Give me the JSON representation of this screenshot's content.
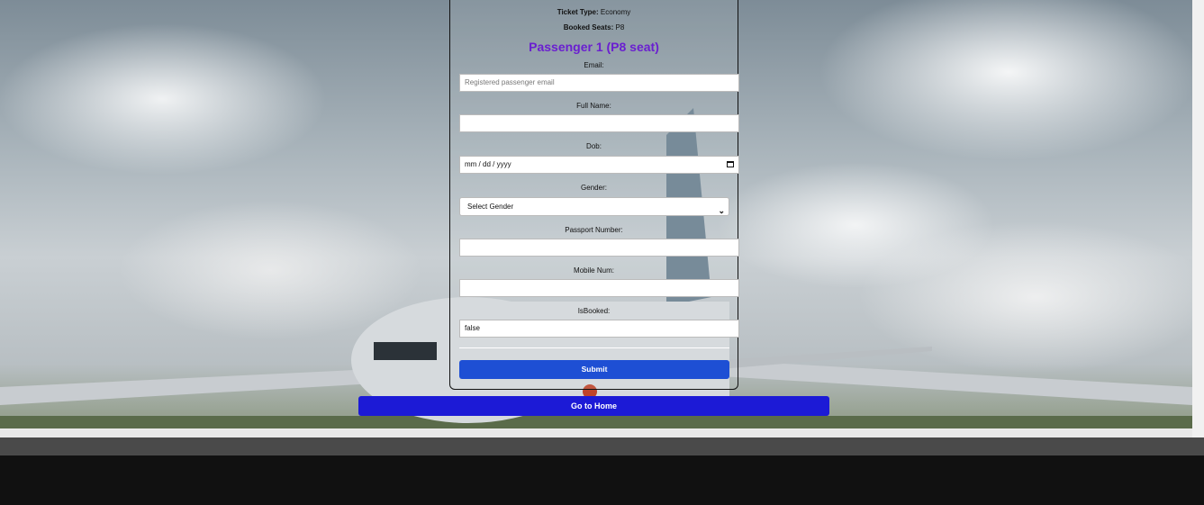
{
  "booking": {
    "ticket_type_label": "Ticket Type:",
    "ticket_type_value": "Economy",
    "booked_seats_label": "Booked Seats:",
    "booked_seats_value": "P8"
  },
  "passenger": {
    "title": "Passenger 1 (P8 seat)",
    "fields": {
      "email_label": "Email:",
      "email_placeholder": "Registered passenger email",
      "fullname_label": "Full Name:",
      "dob_label": "Dob:",
      "dob_placeholder": "mm / dd / yyyy",
      "gender_label": "Gender:",
      "gender_selected": "Select Gender",
      "passport_label": "Passport Number:",
      "mobile_label": "Mobile Num:",
      "isbooked_label": "IsBooked:",
      "isbooked_value": "false"
    },
    "submit_label": "Submit"
  },
  "home_button_label": "Go to Home",
  "icons": {
    "date": "calendar-icon",
    "select": "chevron-down-icon"
  },
  "colors": {
    "title": "#6a1fd0",
    "submit": "#1e4fd4",
    "home": "#1c1ad6"
  }
}
